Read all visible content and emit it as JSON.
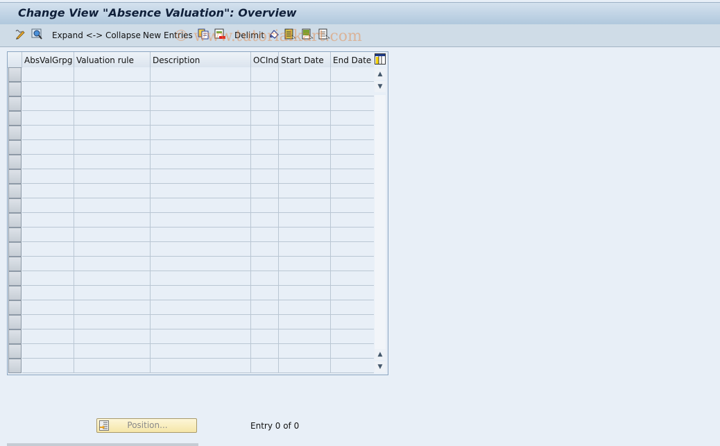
{
  "window": {
    "title": "Change View \"Absence Valuation\": Overview"
  },
  "toolbar": {
    "items": [
      {
        "type": "icon",
        "name": "display-change-icon"
      },
      {
        "type": "icon",
        "name": "find-icon"
      },
      {
        "type": "text",
        "label": "Expand <-> Collapse"
      },
      {
        "type": "text",
        "label": "New Entries"
      },
      {
        "type": "icon",
        "name": "copy-as-icon"
      },
      {
        "type": "icon",
        "name": "delete-icon"
      },
      {
        "type": "text",
        "label": "Delimit"
      },
      {
        "type": "icon",
        "name": "undo-change-icon"
      },
      {
        "type": "icon",
        "name": "select-all-icon"
      },
      {
        "type": "icon",
        "name": "select-block-icon"
      },
      {
        "type": "icon",
        "name": "deselect-all-icon"
      }
    ],
    "expand_collapse_label": "Expand <-> Collapse",
    "new_entries_label": "New Entries",
    "delimit_label": "Delimit"
  },
  "watermark": "© www.tutorialkart.com",
  "table": {
    "columns": [
      "AbsValGrpg",
      "Valuation rule",
      "Description",
      "OCInd",
      "Start Date",
      "End Date"
    ],
    "row_count_visible": 21,
    "rows": []
  },
  "footer": {
    "position_button_label": "Position...",
    "entry_text": "Entry 0 of 0"
  }
}
